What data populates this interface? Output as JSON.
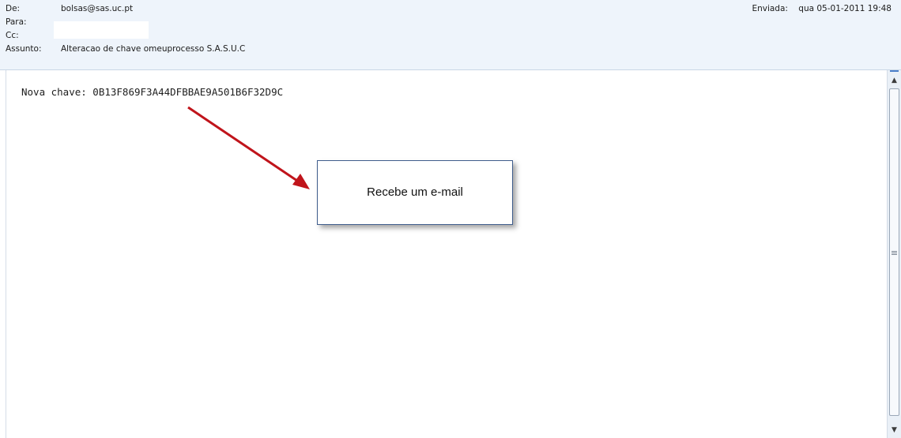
{
  "email": {
    "from_label": "De:",
    "from_value": "bolsas@sas.uc.pt",
    "to_label": "Para:",
    "to_value": "",
    "cc_label": "Cc:",
    "subject_label": "Assunto:",
    "subject_value": "Alteracao de chave omeuprocesso S.A.S.U.C",
    "sent_label": "Enviada:",
    "sent_value": "qua 05-01-2011 19:48",
    "body_text": "Nova chave: 0B13F869F3A44DFBBAE9A501B6F32D9C"
  },
  "callout": {
    "text": "Recebe um e-mail"
  },
  "colors": {
    "header_bg": "#eef4fb",
    "arrow": "#c0141b",
    "callout_border": "#3f5d8c"
  },
  "icons": {
    "scroll_up": "up-arrow-icon",
    "scroll_down": "down-arrow-icon",
    "grip": "grip-icon"
  }
}
